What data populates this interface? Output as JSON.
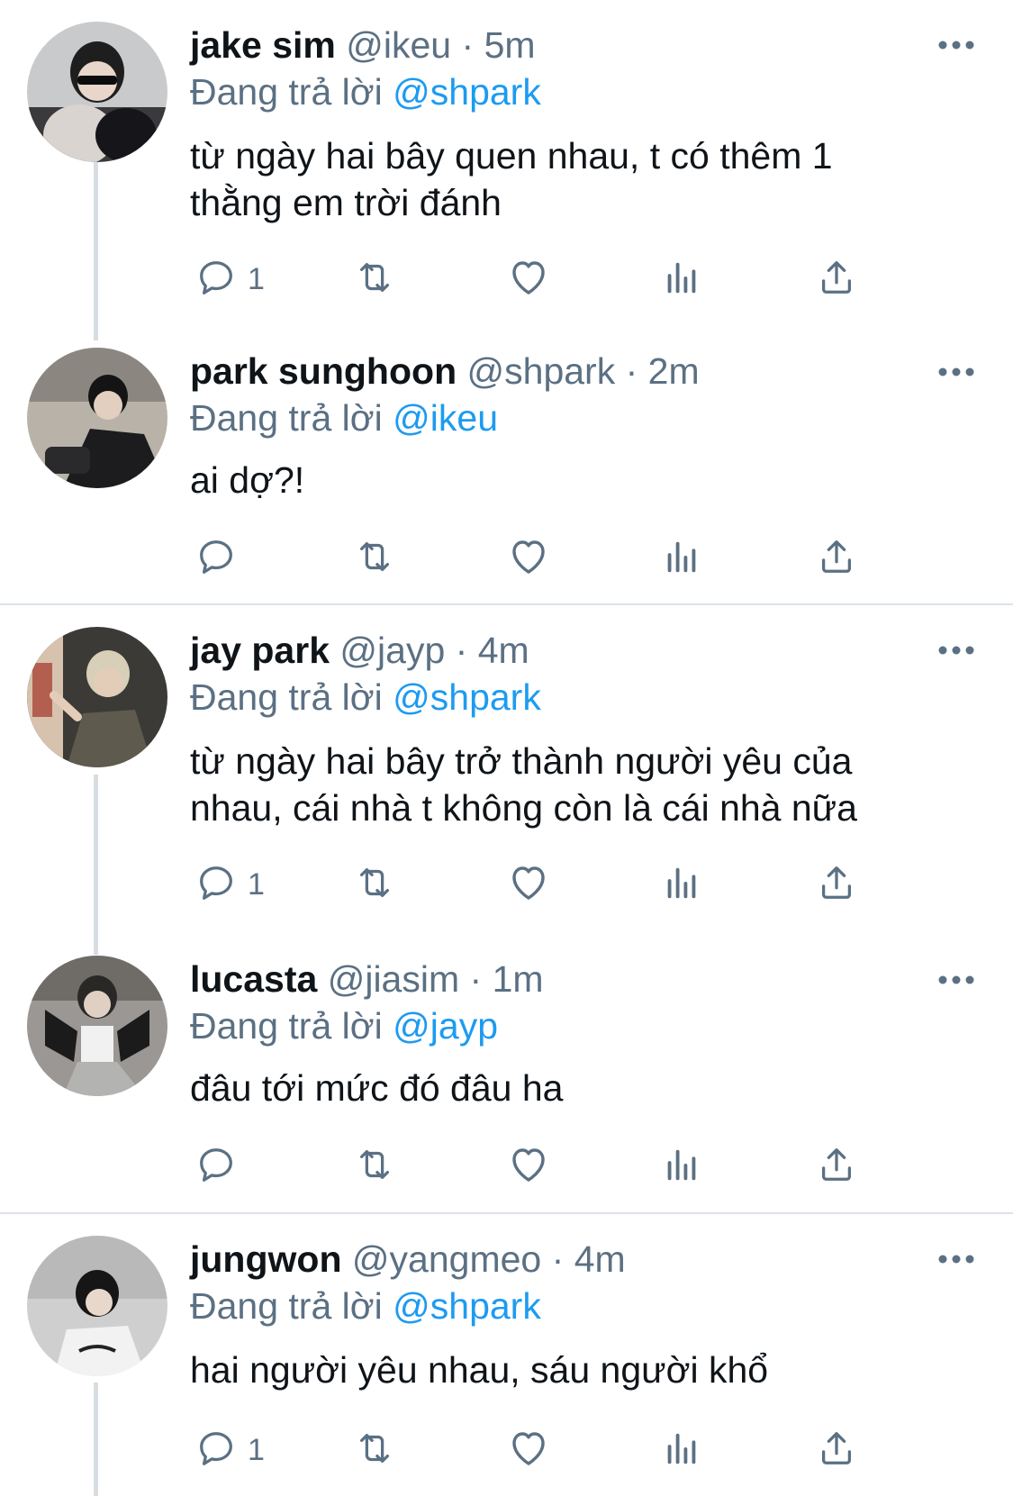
{
  "tweets": [
    {
      "name": "jake sim",
      "handle": "@ikeu",
      "time": "5m",
      "replying_label": "Đang trả lời",
      "replying_to": "@shpark",
      "text": "từ ngày hai bây quen nhau, t có thêm 1 thằng em trời đánh",
      "reply_count": "1"
    },
    {
      "name": "park sunghoon",
      "handle": "@shpark",
      "time": "2m",
      "replying_label": "Đang trả lời",
      "replying_to": "@ikeu",
      "text": "ai dợ?!",
      "reply_count": ""
    },
    {
      "name": "jay park",
      "handle": "@jayp",
      "time": "4m",
      "replying_label": "Đang trả lời",
      "replying_to": "@shpark",
      "text": "từ ngày hai bây trở thành người yêu của nhau, cái nhà t không còn là cái nhà nữa",
      "reply_count": "1"
    },
    {
      "name": "lucasta",
      "handle": "@jiasim",
      "time": "1m",
      "replying_label": "Đang trả lời",
      "replying_to": "@jayp",
      "text": "đâu tới mức đó đâu ha",
      "reply_count": ""
    },
    {
      "name": "jungwon",
      "handle": "@yangmeo",
      "time": "4m",
      "replying_label": "Đang trả lời",
      "replying_to": "@shpark",
      "text": "hai người yêu nhau, sáu người khổ",
      "reply_count": "1"
    }
  ],
  "separator": "·",
  "icons": [
    "reply-icon",
    "retweet-icon",
    "like-icon",
    "analytics-icon",
    "share-icon",
    "more-icon"
  ],
  "colors": {
    "text": "#0f1419",
    "secondary": "#5b7083",
    "link": "#1d9bf0",
    "thread_line": "#d6dde3",
    "divider": "#dde3e8"
  }
}
